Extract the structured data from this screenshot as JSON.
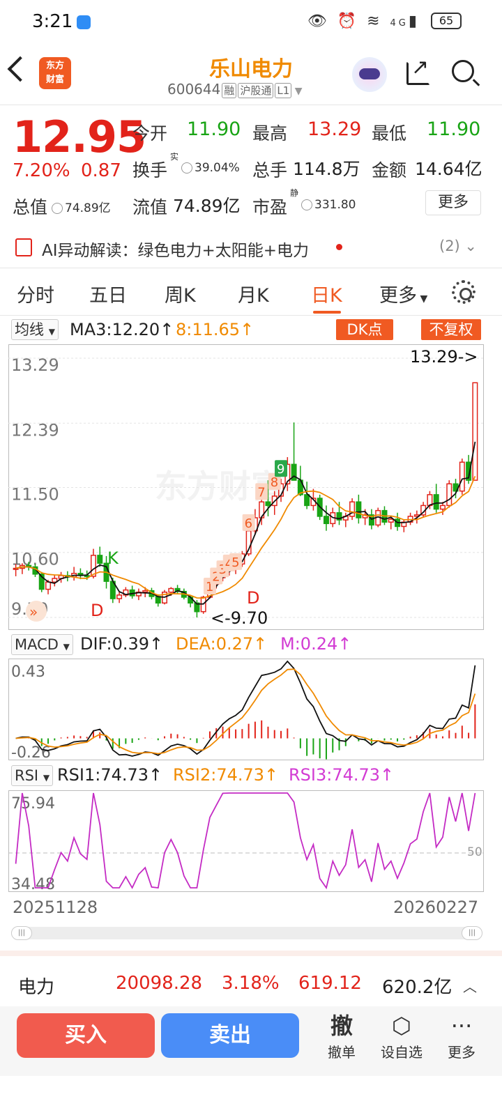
{
  "status_bar": {
    "time": "3:21",
    "battery": "65",
    "network": "4G"
  },
  "header": {
    "logo_line1": "东方",
    "logo_line2": "财富",
    "stock_name": "乐山电力",
    "stock_code": "600644",
    "tags": [
      "融",
      "沪股通",
      "L1"
    ]
  },
  "quote": {
    "price": "12.95",
    "change_pct": "7.20%",
    "change_abs": "0.87",
    "open_label": "今开",
    "open": "11.90",
    "high_label": "最高",
    "high": "13.29",
    "low_label": "最低",
    "low": "11.90",
    "turnover_label": "换手",
    "turnover_sup": "实",
    "turnover": "39.04%",
    "volume_label": "总手",
    "volume": "114.8万",
    "amount_label": "金额",
    "amount": "14.64亿",
    "mktcap_label": "总值",
    "mktcap": "74.89亿",
    "float_label": "流值",
    "float_cap": "74.89亿",
    "pe_label": "市盈",
    "pe_sup": "静",
    "pe": "331.80",
    "more": "更多"
  },
  "ai_bar": {
    "text": "AI异动解读：绿色电力+太阳能+电力",
    "count": "(2)"
  },
  "tabs": [
    "分时",
    "五日",
    "周K",
    "月K",
    "日K",
    "更多"
  ],
  "active_tab": "日K",
  "kline": {
    "indicator_select": "均线",
    "ma3": "MA3:12.20↑",
    "ma8": "8:11.65↑",
    "dk_button": "DK点",
    "adjust_button": "不复权",
    "y_labels": [
      "13.29",
      "12.39",
      "11.50",
      "10.60",
      "9.70"
    ],
    "high_marker": "13.29->",
    "low_marker": "<-9.70",
    "signal_labels": [
      "K",
      "D",
      "D"
    ],
    "seq_labels": [
      "1",
      "2",
      "3",
      "4",
      "5",
      "6",
      "7",
      "8",
      "9"
    ],
    "watermark": "东方财富"
  },
  "macd": {
    "select": "MACD",
    "dif": "DIF:0.39↑",
    "dea": "DEA:0.27↑",
    "m": "M:0.24↑",
    "top_label": "0.43",
    "bottom_label": "-0.26"
  },
  "rsi": {
    "select": "RSI",
    "rsi1": "RSI1:74.73↑",
    "rsi2": "RSI2:74.73↑",
    "rsi3": "RSI3:74.73↑",
    "top_label": "75.94",
    "bottom_label": "34.48",
    "mid_label": "50"
  },
  "dates": {
    "start": "20251128",
    "end": "20260227"
  },
  "sector": {
    "name": "电力",
    "index": "20098.28",
    "pct": "3.18%",
    "change": "619.12",
    "amount": "620.2亿"
  },
  "actions": {
    "buy": "买入",
    "sell": "卖出",
    "cancel_icon_char": "撤",
    "cancel": "撤单",
    "watchlist": "设自选",
    "more": "更多"
  },
  "chart_data": [
    {
      "type": "candlestick",
      "title": "日K",
      "ylim": [
        9.7,
        13.29
      ],
      "ohlc": [
        [
          10.38,
          10.44,
          10.27,
          10.38
        ],
        [
          10.38,
          10.45,
          10.3,
          10.42
        ],
        [
          10.42,
          10.47,
          10.35,
          10.4
        ],
        [
          10.4,
          10.44,
          10.26,
          10.3
        ],
        [
          10.3,
          10.33,
          10.05,
          10.09
        ],
        [
          10.09,
          10.22,
          10.02,
          10.19
        ],
        [
          10.19,
          10.29,
          10.13,
          10.24
        ],
        [
          10.24,
          10.33,
          10.18,
          10.28
        ],
        [
          10.28,
          10.34,
          10.2,
          10.26
        ],
        [
          10.26,
          10.4,
          10.21,
          10.31
        ],
        [
          10.31,
          10.38,
          10.23,
          10.28
        ],
        [
          10.28,
          10.35,
          10.22,
          10.27
        ],
        [
          10.27,
          10.65,
          10.24,
          10.56
        ],
        [
          10.56,
          10.68,
          10.4,
          10.45
        ],
        [
          10.45,
          10.55,
          10.1,
          10.2
        ],
        [
          10.2,
          10.25,
          9.9,
          9.96
        ],
        [
          9.96,
          10.05,
          9.9,
          10.01
        ],
        [
          10.01,
          10.12,
          9.98,
          10.08
        ],
        [
          10.08,
          10.14,
          9.96,
          10.0
        ],
        [
          10.0,
          10.1,
          9.94,
          10.05
        ],
        [
          10.05,
          10.12,
          9.98,
          10.07
        ],
        [
          10.07,
          10.11,
          9.95,
          9.99
        ],
        [
          9.99,
          10.02,
          9.85,
          9.9
        ],
        [
          9.9,
          10.08,
          9.88,
          10.05
        ],
        [
          10.05,
          10.12,
          10.0,
          10.1
        ],
        [
          10.1,
          10.15,
          10.03,
          10.06
        ],
        [
          10.06,
          10.1,
          9.95,
          9.98
        ],
        [
          9.98,
          10.0,
          9.84,
          9.9
        ],
        [
          9.9,
          9.94,
          9.7,
          9.78
        ],
        [
          9.78,
          10.0,
          9.75,
          9.98
        ],
        [
          9.98,
          10.2,
          9.96,
          10.16
        ],
        [
          10.16,
          10.3,
          10.1,
          10.25
        ],
        [
          10.25,
          10.38,
          10.2,
          10.35
        ],
        [
          10.35,
          10.45,
          10.28,
          10.4
        ],
        [
          10.4,
          10.5,
          10.3,
          10.44
        ],
        [
          10.44,
          10.62,
          10.4,
          10.58
        ],
        [
          10.58,
          10.95,
          10.55,
          10.9
        ],
        [
          10.9,
          11.2,
          10.85,
          11.08
        ],
        [
          11.08,
          11.4,
          10.98,
          11.3
        ],
        [
          11.3,
          11.6,
          11.1,
          11.25
        ],
        [
          11.25,
          11.45,
          11.12,
          11.38
        ],
        [
          11.38,
          11.62,
          11.3,
          11.55
        ],
        [
          11.55,
          11.92,
          11.45,
          11.82
        ],
        [
          11.82,
          12.4,
          11.7,
          11.6
        ],
        [
          11.6,
          11.8,
          11.38,
          11.4
        ],
        [
          11.4,
          11.58,
          11.2,
          11.25
        ],
        [
          11.25,
          11.48,
          11.18,
          11.35
        ],
        [
          11.35,
          11.4,
          11.05,
          11.1
        ],
        [
          11.1,
          11.25,
          10.9,
          11.0
        ],
        [
          11.0,
          11.22,
          10.95,
          11.15
        ],
        [
          11.15,
          11.3,
          10.98,
          11.05
        ],
        [
          11.05,
          11.15,
          10.95,
          11.1
        ],
        [
          11.1,
          11.35,
          11.05,
          11.3
        ],
        [
          11.3,
          11.4,
          11.0,
          11.08
        ],
        [
          11.08,
          11.2,
          10.98,
          11.12
        ],
        [
          11.12,
          11.2,
          10.92,
          10.98
        ],
        [
          10.98,
          11.22,
          10.95,
          11.18
        ],
        [
          11.18,
          11.24,
          10.98,
          11.02
        ],
        [
          11.02,
          11.1,
          10.92,
          11.06
        ],
        [
          11.06,
          11.15,
          10.9,
          10.96
        ],
        [
          10.96,
          11.05,
          10.88,
          11.02
        ],
        [
          11.02,
          11.15,
          10.98,
          11.1
        ],
        [
          11.1,
          11.18,
          11.0,
          11.12
        ],
        [
          11.12,
          11.3,
          11.08,
          11.25
        ],
        [
          11.25,
          11.45,
          11.2,
          11.4
        ],
        [
          11.4,
          11.55,
          11.15,
          11.2
        ],
        [
          11.2,
          11.3,
          11.12,
          11.25
        ],
        [
          11.25,
          11.6,
          11.22,
          11.55
        ],
        [
          11.55,
          11.62,
          11.35,
          11.45
        ],
        [
          11.45,
          11.9,
          11.4,
          11.85
        ],
        [
          11.85,
          11.95,
          11.55,
          11.6
        ],
        [
          11.6,
          12.95,
          11.9,
          12.95
        ]
      ],
      "series": [
        {
          "name": "MA3",
          "last": 12.2
        },
        {
          "name": "8",
          "last": 11.65
        }
      ]
    },
    {
      "type": "bar+line",
      "title": "MACD",
      "ylim": [
        -0.26,
        0.43
      ],
      "series": [
        {
          "name": "DIF",
          "last": 0.39
        },
        {
          "name": "DEA",
          "last": 0.27
        },
        {
          "name": "M",
          "last": 0.24
        }
      ]
    },
    {
      "type": "line",
      "title": "RSI",
      "ylim": [
        34.48,
        75.94
      ],
      "series": [
        {
          "name": "RSI1",
          "last": 74.73
        },
        {
          "name": "RSI2",
          "last": 74.73
        },
        {
          "name": "RSI3",
          "last": 74.73
        }
      ]
    }
  ]
}
